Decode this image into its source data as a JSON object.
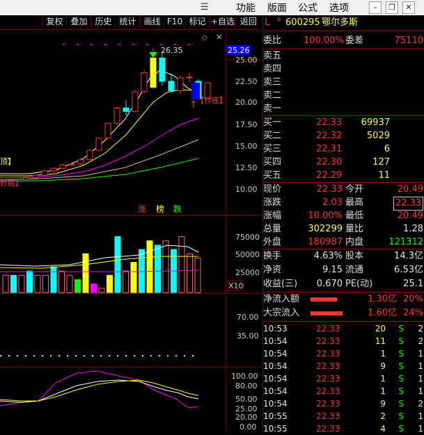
{
  "menubar": {
    "items": [
      "功能",
      "版面",
      "公式",
      "选项"
    ]
  },
  "toolbar": {
    "buttons": [
      "复权",
      "叠加",
      "历史",
      "统计",
      "画线",
      "F10",
      "标记",
      "+自选",
      "返回"
    ]
  },
  "main_chart": {
    "y_ticks": [
      "25.00",
      "22.50",
      "20.00",
      "17.50",
      "15.00",
      "12.50",
      "10.00"
    ],
    "price_tag": "25.26",
    "high_label": "26.35",
    "abnormal_label": "【抄底】",
    "left_label_1": "顶】",
    "left_label_2": "抄底】",
    "tags": [
      "涨",
      "榜",
      "跌"
    ],
    "candles": [
      {
        "o": 11.1,
        "h": 11.4,
        "l": 10.9,
        "c": 11.3,
        "up": true
      },
      {
        "o": 11.3,
        "h": 11.7,
        "l": 11.2,
        "c": 11.6,
        "up": true
      },
      {
        "o": 11.6,
        "h": 12.2,
        "l": 11.5,
        "c": 12.1,
        "up": true
      },
      {
        "o": 12.1,
        "h": 12.5,
        "l": 11.9,
        "c": 12.4,
        "up": true
      },
      {
        "o": 12.4,
        "h": 12.9,
        "l": 12.3,
        "c": 12.8,
        "up": true
      },
      {
        "o": 12.8,
        "h": 13.1,
        "l": 12.6,
        "c": 12.9,
        "up": true
      },
      {
        "o": 12.9,
        "h": 13.6,
        "l": 12.8,
        "c": 13.4,
        "up": true
      },
      {
        "o": 13.4,
        "h": 14.6,
        "l": 13.3,
        "c": 14.5,
        "up": true
      },
      {
        "o": 14.5,
        "h": 16.0,
        "l": 14.4,
        "c": 15.9,
        "up": true
      },
      {
        "o": 15.9,
        "h": 17.7,
        "l": 15.8,
        "c": 17.6,
        "up": true
      },
      {
        "o": 17.6,
        "h": 19.6,
        "l": 17.4,
        "c": 19.4,
        "up": true
      },
      {
        "o": 19.4,
        "h": 20.3,
        "l": 18.5,
        "c": 19.0,
        "up": false
      },
      {
        "o": 19.0,
        "h": 21.5,
        "l": 18.9,
        "c": 21.3,
        "up": true
      },
      {
        "o": 21.3,
        "h": 23.8,
        "l": 21.1,
        "c": 23.5,
        "up": true
      },
      {
        "o": 21.8,
        "h": 26.35,
        "l": 21.6,
        "c": 25.2,
        "up": true
      },
      {
        "o": 25.2,
        "h": 25.8,
        "l": 22.0,
        "c": 22.5,
        "up": false
      },
      {
        "o": 22.5,
        "h": 23.4,
        "l": 21.2,
        "c": 21.4,
        "up": false
      },
      {
        "o": 21.4,
        "h": 23.2,
        "l": 21.0,
        "c": 22.9,
        "up": true
      },
      {
        "o": 22.9,
        "h": 23.5,
        "l": 22.4,
        "c": 23.0,
        "up": true
      },
      {
        "o": 22.5,
        "h": 22.7,
        "l": 20.4,
        "c": 20.5,
        "up": false
      },
      {
        "o": 20.5,
        "h": 22.4,
        "l": 20.4,
        "c": 22.33,
        "up": true
      }
    ]
  },
  "volume_chart": {
    "y_ticks": [
      "75000",
      "50000",
      "25000"
    ],
    "multiplier": "X10",
    "bars": [
      4,
      4,
      4,
      5,
      4,
      4,
      6,
      5,
      4,
      3,
      9,
      2,
      1,
      4,
      13,
      5,
      7,
      10,
      12,
      11,
      12,
      10,
      13,
      9,
      8
    ]
  },
  "indicator_1": {
    "y_ticks": [
      "70.00",
      "35.00"
    ]
  },
  "indicator_2": {
    "y_ticks": [
      "100.00",
      "80.00",
      "50.00",
      "25.00",
      "20.00",
      "0.00"
    ]
  },
  "quote": {
    "code_prefix": "L",
    "code_sup": "R",
    "stock_code": "600295",
    "stock_name": "鄂尔多斯",
    "weibi_label": "委比",
    "weibi": "100.00%",
    "weicha_label": "委差",
    "weicha": "75110",
    "sell": [
      {
        "label": "卖五"
      },
      {
        "label": "卖四"
      },
      {
        "label": "卖三"
      },
      {
        "label": "卖二"
      },
      {
        "label": "卖一"
      }
    ],
    "buy": [
      {
        "label": "买一",
        "price": "22.33",
        "vol": "69937"
      },
      {
        "label": "买二",
        "price": "22.32",
        "vol": "5029"
      },
      {
        "label": "买三",
        "price": "22.31",
        "vol": "6"
      },
      {
        "label": "买四",
        "price": "22.30",
        "vol": "127"
      },
      {
        "label": "买五",
        "price": "22.29",
        "vol": "11"
      }
    ],
    "stats": [
      {
        "l1": "现价",
        "v1": "22.33",
        "l2": "今开",
        "v2": "20.49"
      },
      {
        "l1": "涨跌",
        "v1": "2.03",
        "l2": "最高",
        "v2": "22.33"
      },
      {
        "l1": "涨幅",
        "v1": "10.00%",
        "l2": "最低",
        "v2": "20.49"
      },
      {
        "l1": "总量",
        "v1": "302299",
        "l2": "量比",
        "v2": "1.28"
      },
      {
        "l1": "外盘",
        "v1": "180987",
        "l2": "内盘",
        "v2": "121312"
      }
    ],
    "stats2": [
      {
        "l1": "换手",
        "v1": "4.63%",
        "l2": "股本",
        "v2": "14.3亿"
      },
      {
        "l1": "净资",
        "v1": "9.15",
        "l2": "流通",
        "v2": "6.53亿"
      },
      {
        "l1": "收益(三)",
        "v1": "0.670",
        "l2": "PE(动)",
        "v2": "25.1"
      }
    ],
    "flows": [
      {
        "label": "净流入额",
        "value": "1.30亿",
        "pct": "20%",
        "bar": 0.8
      },
      {
        "label": "大宗流入",
        "value": "1.60亿",
        "pct": "24%",
        "bar": 0.95
      }
    ],
    "ticks": [
      {
        "time": "10:53",
        "price": "22.33",
        "vol": "20",
        "side": "S",
        "n": "2"
      },
      {
        "time": "10:54",
        "price": "22.33",
        "vol": "11",
        "side": "S",
        "n": "2"
      },
      {
        "time": "10:54",
        "price": "22.33",
        "vol": "1",
        "side": "S",
        "n": "1"
      },
      {
        "time": "10:54",
        "price": "22.33",
        "vol": "9",
        "side": "S",
        "n": "1"
      },
      {
        "time": "10:54",
        "price": "22.33",
        "vol": "1",
        "side": "S",
        "n": "1"
      },
      {
        "time": "10:54",
        "price": "22.33",
        "vol": "1",
        "side": "S",
        "n": "1"
      },
      {
        "time": "10:54",
        "price": "22.33",
        "vol": "9",
        "side": "S",
        "n": "2"
      },
      {
        "time": "10:55",
        "price": "22.33",
        "vol": "2",
        "side": "S",
        "n": "1"
      },
      {
        "time": "10:55",
        "price": "22.33",
        "vol": "4",
        "side": "S",
        "n": "1"
      }
    ]
  },
  "colors": {
    "up": "#ff3333",
    "down": "#00ffff",
    "ma5": "#ffffff",
    "ma10": "#ffff00",
    "ma20": "#ff00ff",
    "ma60": "#00ff00",
    "grid": "#8a0000"
  }
}
